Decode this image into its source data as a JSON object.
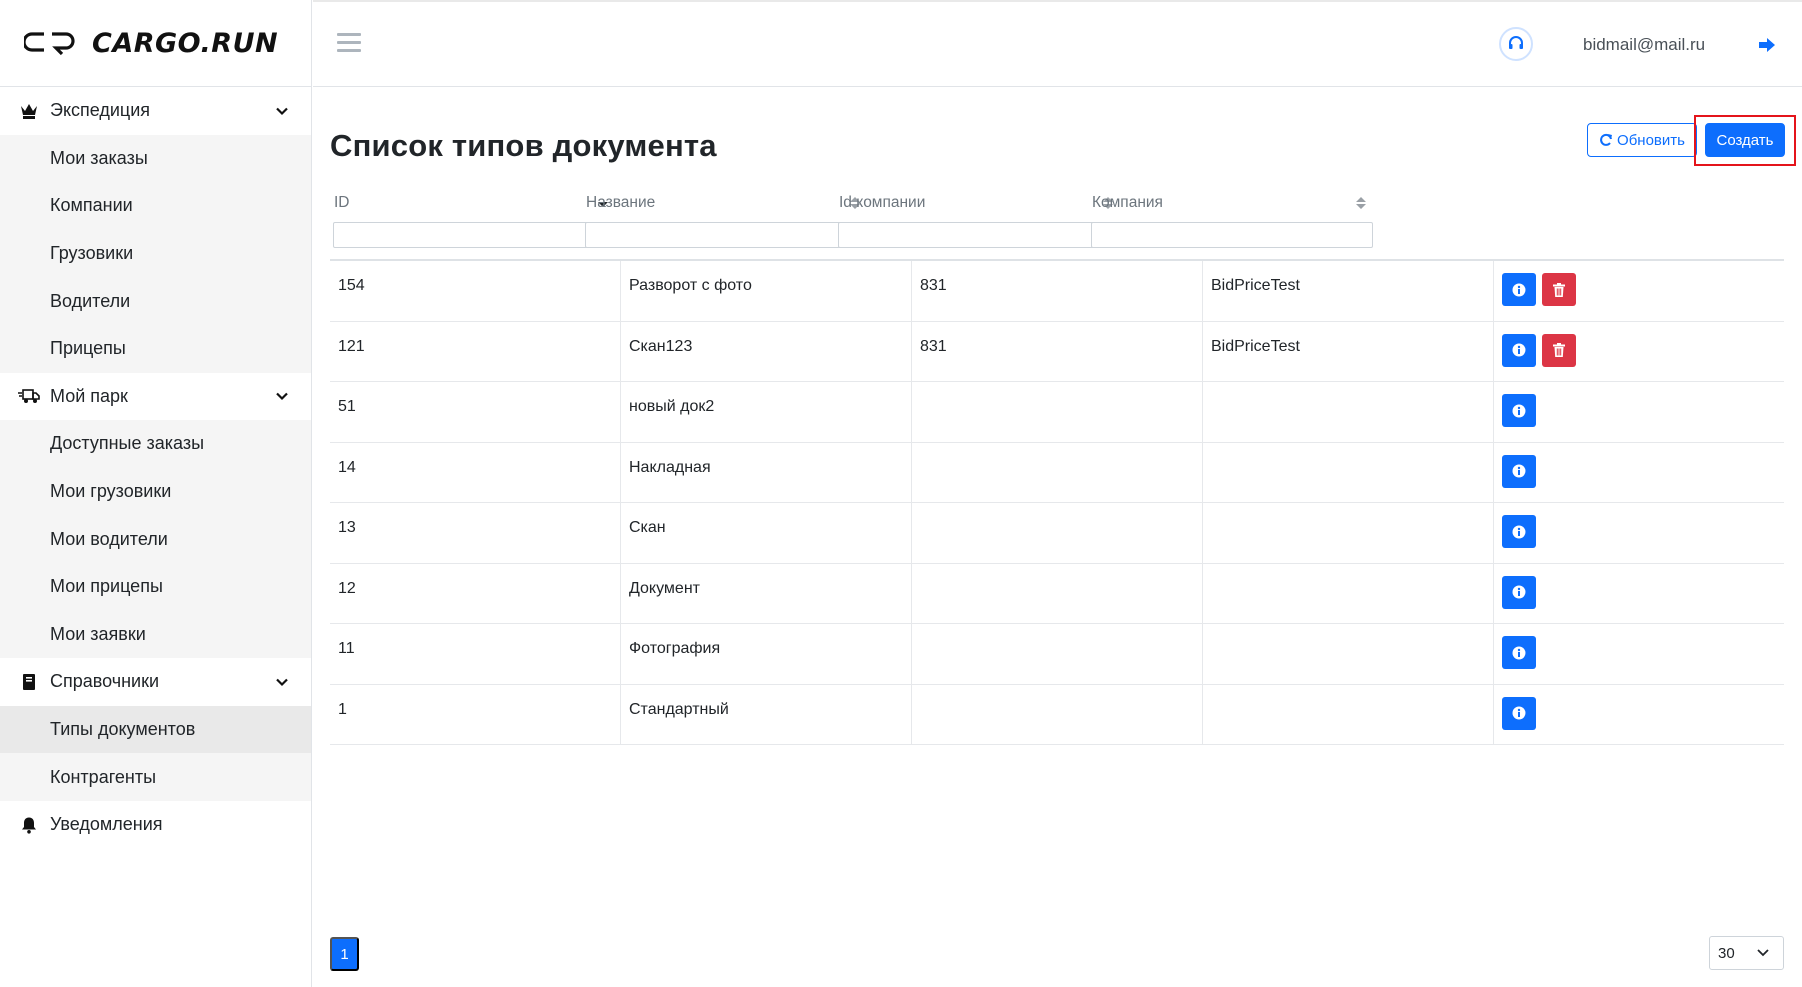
{
  "brand": {
    "name": "CARGO.RUN"
  },
  "header": {
    "user_email": "bidmail@mail.ru"
  },
  "sidebar": {
    "items": [
      {
        "label": "Экспедиция",
        "type": "parent",
        "icon": "crown-icon"
      },
      {
        "label": "Мои заказы",
        "type": "child"
      },
      {
        "label": "Компании",
        "type": "child"
      },
      {
        "label": "Грузовики",
        "type": "child"
      },
      {
        "label": "Водители",
        "type": "child"
      },
      {
        "label": "Прицепы",
        "type": "child"
      },
      {
        "label": "Мой парк",
        "type": "parent",
        "icon": "truck-icon"
      },
      {
        "label": "Доступные заказы",
        "type": "child"
      },
      {
        "label": "Мои грузовики",
        "type": "child"
      },
      {
        "label": "Мои водители",
        "type": "child"
      },
      {
        "label": "Мои прицепы",
        "type": "child"
      },
      {
        "label": "Мои заявки",
        "type": "child"
      },
      {
        "label": "Справочники",
        "type": "parent",
        "icon": "book-icon"
      },
      {
        "label": "Типы документов",
        "type": "child",
        "active": true
      },
      {
        "label": "Контрагенты",
        "type": "child"
      },
      {
        "label": "Уведомления",
        "type": "parent",
        "icon": "bell-icon"
      }
    ]
  },
  "page": {
    "title": "Список типов документа",
    "refresh_label": "Обновить",
    "create_label": "Создать"
  },
  "table": {
    "columns": [
      "ID",
      "Название",
      "Id компании",
      "Компания"
    ],
    "rows": [
      {
        "id": "154",
        "name": "Разворот с фото",
        "company_id": "831",
        "company": "BidPriceTest",
        "deletable": true
      },
      {
        "id": "121",
        "name": "Скан123",
        "company_id": "831",
        "company": "BidPriceTest",
        "deletable": true
      },
      {
        "id": "51",
        "name": "новый док2",
        "company_id": "",
        "company": "",
        "deletable": false
      },
      {
        "id": "14",
        "name": "Накладная",
        "company_id": "",
        "company": "",
        "deletable": false
      },
      {
        "id": "13",
        "name": "Скан",
        "company_id": "",
        "company": "",
        "deletable": false
      },
      {
        "id": "12",
        "name": "Документ",
        "company_id": "",
        "company": "",
        "deletable": false
      },
      {
        "id": "11",
        "name": "Фотография",
        "company_id": "",
        "company": "",
        "deletable": false
      },
      {
        "id": "1",
        "name": "Стандартный",
        "company_id": "",
        "company": "",
        "deletable": false
      }
    ]
  },
  "pagination": {
    "current_page": "1",
    "page_size": "30"
  },
  "colors": {
    "primary": "#0d6efd",
    "danger": "#dc3545",
    "highlight": "#e4141b"
  }
}
